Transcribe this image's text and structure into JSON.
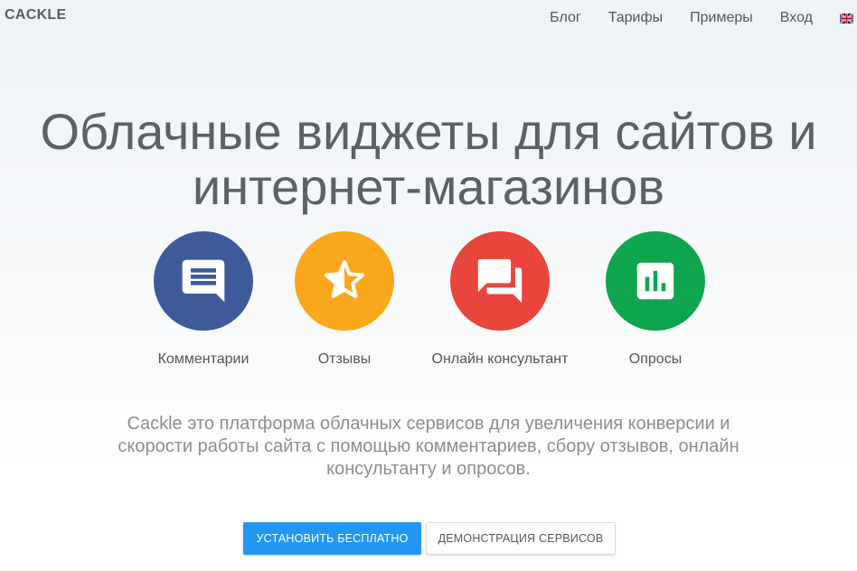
{
  "header": {
    "logo": "CACKLE",
    "nav": [
      {
        "label": "Блог"
      },
      {
        "label": "Тарифы"
      },
      {
        "label": "Примеры"
      },
      {
        "label": "Вход"
      }
    ],
    "language_icon": "uk-flag-icon"
  },
  "hero": {
    "title_lines": [
      "Облачные виджеты для сайтов и",
      "интернет-магазинов"
    ],
    "features": [
      {
        "label": "Комментарии",
        "icon": "comment-icon",
        "color": "#3d5a99"
      },
      {
        "label": "Отзывы",
        "icon": "star-half-icon",
        "color": "#f9a81b"
      },
      {
        "label": "Онлайн консультант",
        "icon": "forum-icon",
        "color": "#e8463c"
      },
      {
        "label": "Опросы",
        "icon": "poll-icon",
        "color": "#0ea54e"
      }
    ],
    "description_lines": [
      "Cackle это платформа облачных сервисов для увеличения конверсии и",
      "скорости работы сайта с помощью комментариев, сбору отзывов, онлайн",
      "консультанту и опросов."
    ],
    "buttons": {
      "primary": "УСТАНОВИТЬ БЕСПЛАТНО",
      "secondary": "ДЕМОНСТРАЦИЯ СЕРВИСОВ"
    }
  },
  "colors": {
    "primary_button": "#2196f3",
    "title_text": "#5c6067",
    "description_text": "#8a8e93"
  }
}
